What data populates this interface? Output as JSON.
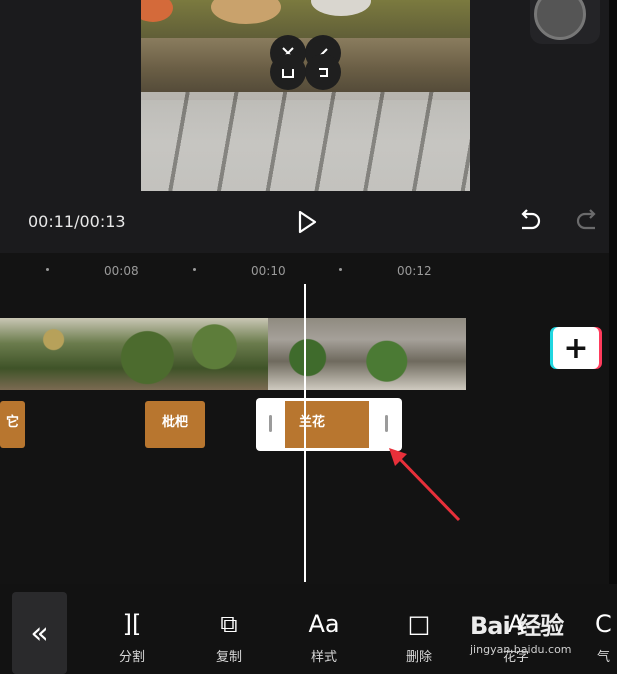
{
  "player": {
    "time_display": "00:11/00:13",
    "icons": {
      "play": "play-icon",
      "undo": "undo-icon",
      "redo": "redo-icon",
      "delete_overlay": "close-icon",
      "rotate_overlay": "rotate-icon"
    }
  },
  "timeline": {
    "ruler": [
      "00:08",
      "00:10",
      "00:12"
    ],
    "text_tags": [
      {
        "label": "它"
      },
      {
        "label": "枇杷"
      },
      {
        "label": "兰花",
        "selected": true
      }
    ],
    "add_clip_symbol": "+"
  },
  "toolbar": {
    "back_symbol": "«",
    "tools": [
      {
        "label": "分割",
        "icon": "split-icon",
        "glyph": "]["
      },
      {
        "label": "复制",
        "icon": "copy-icon",
        "glyph": "⧉"
      },
      {
        "label": "样式",
        "icon": "text-style-icon",
        "glyph": "Aa"
      },
      {
        "label": "删除",
        "icon": "delete-icon",
        "glyph": "□"
      },
      {
        "label": "花字",
        "icon": "fancy-text-icon",
        "glyph": "A"
      },
      {
        "label": "气",
        "icon": "bubble-icon",
        "glyph": "C"
      }
    ]
  },
  "watermark": {
    "brand": "Bai 经验",
    "url": "jingyan.baidu.com"
  },
  "colors": {
    "tag": "#b8762f",
    "background": "#131313",
    "accent_cyan": "#20d6e0",
    "accent_red": "#ff3b5c",
    "arrow": "#e8303a"
  }
}
